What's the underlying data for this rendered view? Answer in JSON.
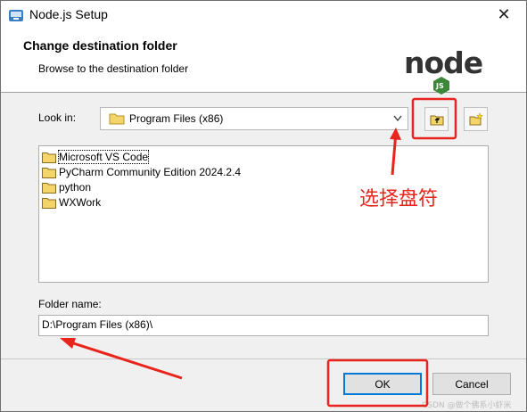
{
  "window": {
    "title": "Node.js Setup",
    "close_glyph": "✕"
  },
  "header": {
    "title": "Change destination folder",
    "subtitle": "Browse to the destination folder",
    "logo_text": "node",
    "logo_badge": "JS"
  },
  "look_in": {
    "label": "Look in:",
    "value": "Program Files (x86)",
    "icon": "folder-icon",
    "up_button_icon": "up-one-level-icon",
    "new_folder_button_icon": "new-folder-icon"
  },
  "folders": [
    {
      "name": "Microsoft VS Code"
    },
    {
      "name": "PyCharm Community Edition 2024.2.4"
    },
    {
      "name": "python"
    },
    {
      "name": "WXWork"
    }
  ],
  "folder_name": {
    "label": "Folder name:",
    "value": "D:\\Program Files (x86)\\"
  },
  "buttons": {
    "ok": "OK",
    "cancel": "Cancel"
  },
  "annotation": {
    "text": "选择盘符",
    "color": "#e8241c"
  },
  "watermark": "CSDN @做个佛系小虾米",
  "colors": {
    "accent": "#0078d7",
    "node_green": "#3c873a",
    "node_dark": "#333333",
    "folder_yellow": "#f4d56a"
  }
}
